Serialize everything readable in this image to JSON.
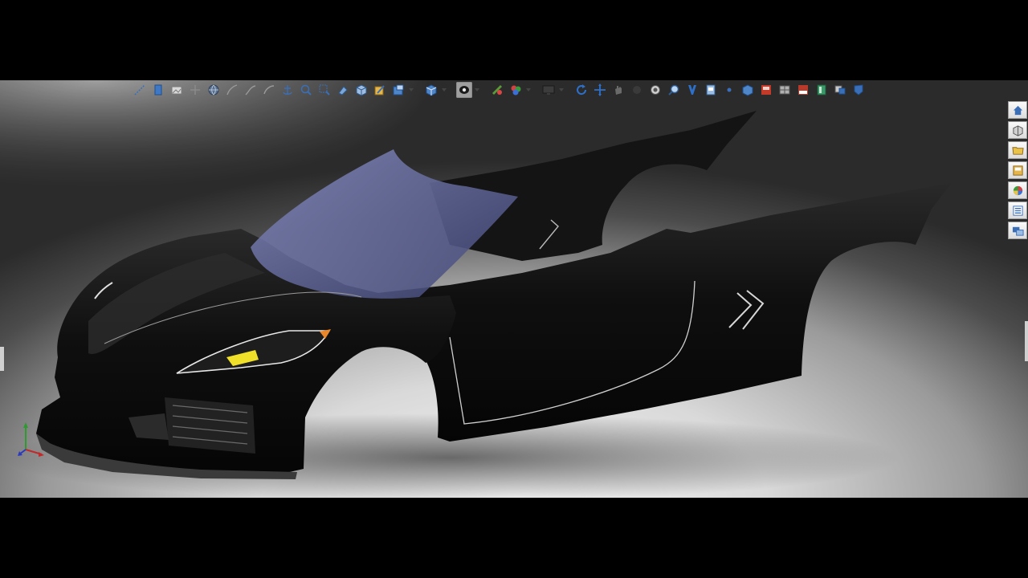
{
  "window": {
    "title": ""
  },
  "toolbar": {
    "buttons": [
      "measure-icon",
      "sketch-blue-icon",
      "image-icon",
      "arrows-icon",
      "globe-icon",
      "curve-icon",
      "curve2-icon",
      "curve3-icon",
      "anchor-icon",
      "zoom-fit-icon",
      "zoom-area-icon",
      "rotate-view-icon",
      "view-cube-icon",
      "section-view-icon",
      "edit-appearance-icon",
      "display-style-icon",
      "hide-show-icon",
      "appearances-icon",
      "scenes-icon",
      "monitor-icon",
      "rotate-icon",
      "pan-icon",
      "hand-icon",
      "sphere-dark-icon",
      "sphere-icon",
      "magnify-icon",
      "tool-icon",
      "box-icon",
      "small-dot-icon",
      "render-icon",
      "pdf-icon",
      "grid-icon",
      "step-export-icon",
      "book-icon",
      "parts-icon",
      "shield-icon"
    ],
    "active": "display-style-icon"
  },
  "taskpane": {
    "items": [
      "home-icon",
      "parts-icon",
      "folder-icon",
      "view-palette-icon",
      "appearances-icon",
      "custom-properties-icon",
      "windows-icon"
    ]
  },
  "colors": {
    "viewport_center": "#f4f4f4",
    "viewport_edge": "#2b2b2b",
    "body_paint": "#111111",
    "windshield": "#5a6190",
    "headlight_accent": "#f0e02a",
    "marker_orange": "#e9872a"
  }
}
